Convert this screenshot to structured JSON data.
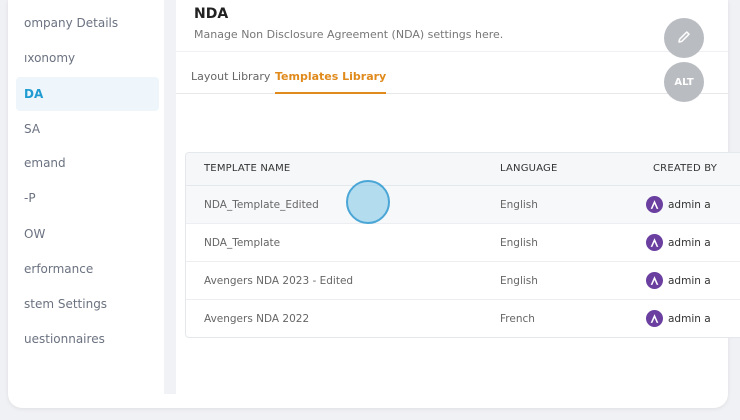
{
  "sidebar": {
    "items": [
      {
        "label": "ompany Details"
      },
      {
        "label": "ıxonomy"
      },
      {
        "label": "DA"
      },
      {
        "label": "SA"
      },
      {
        "label": "emand"
      },
      {
        "label": "-P"
      },
      {
        "label": "OW"
      },
      {
        "label": "erformance"
      },
      {
        "label": "stem Settings"
      },
      {
        "label": "uestionnaires"
      }
    ],
    "active_index": 2
  },
  "header": {
    "title": "NDA",
    "subtitle": "Manage Non Disclosure Agreement (NDA) settings here."
  },
  "tabs": [
    {
      "label": "Layout Library",
      "active": false
    },
    {
      "label": "Templates Library",
      "active": true
    }
  ],
  "table": {
    "columns": [
      "TEMPLATE NAME",
      "LANGUAGE",
      "CREATED BY"
    ],
    "rows": [
      {
        "name": "NDA_Template_Edited",
        "language": "English",
        "created_by": "admin a"
      },
      {
        "name": "NDA_Template",
        "language": "English",
        "created_by": "admin a"
      },
      {
        "name": "Avengers NDA 2023 - Edited",
        "language": "English",
        "created_by": "admin a"
      },
      {
        "name": "Avengers NDA 2022",
        "language": "French",
        "created_by": "admin a"
      }
    ]
  },
  "fabs": {
    "edit_icon": "pencil-icon",
    "alt_label": "ALT"
  },
  "colors": {
    "accent_active_tab": "#e08a1c",
    "sidebar_active": "#1f9bd1",
    "avatar": "#6a3fa0"
  }
}
